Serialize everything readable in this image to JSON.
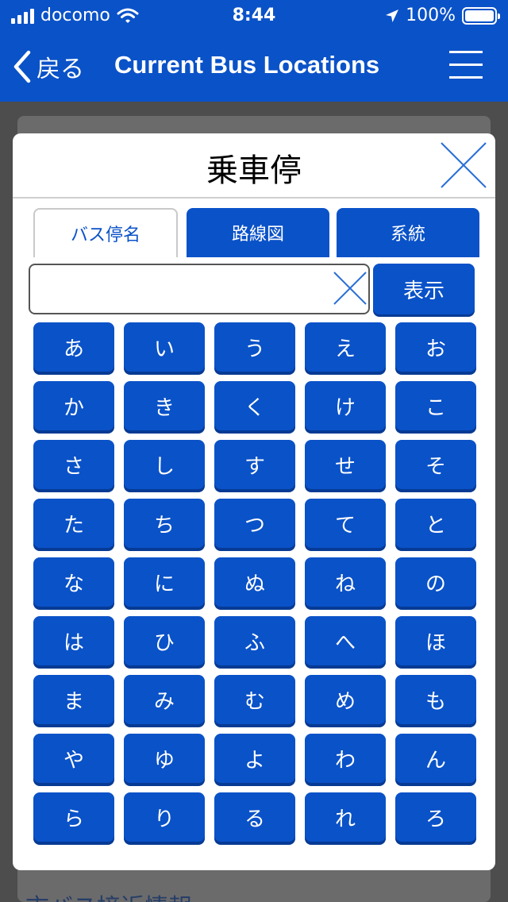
{
  "status_bar": {
    "carrier": "docomo",
    "time": "8:44",
    "battery": "100%"
  },
  "nav": {
    "back_label": "戻る",
    "title": "Current Bus Locations"
  },
  "background": {
    "partial_text": "市バス接近情報"
  },
  "modal": {
    "title": "乗車停",
    "tabs": [
      {
        "label": "バス停名",
        "active": true
      },
      {
        "label": "路線図",
        "active": false
      },
      {
        "label": "系統",
        "active": false
      }
    ],
    "search": {
      "value": "",
      "placeholder": ""
    },
    "display_button": "表示",
    "kana_keys": [
      "あ",
      "い",
      "う",
      "え",
      "お",
      "か",
      "き",
      "く",
      "け",
      "こ",
      "さ",
      "し",
      "す",
      "せ",
      "そ",
      "た",
      "ち",
      "つ",
      "て",
      "と",
      "な",
      "に",
      "ぬ",
      "ね",
      "の",
      "は",
      "ひ",
      "ふ",
      "へ",
      "ほ",
      "ま",
      "み",
      "む",
      "め",
      "も",
      "や",
      "ゆ",
      "よ",
      "わ",
      "ん",
      "ら",
      "り",
      "る",
      "れ",
      "ろ"
    ]
  },
  "colors": {
    "brand_blue": "#0a52c8",
    "overlay_gray": "#4d4d4d"
  }
}
